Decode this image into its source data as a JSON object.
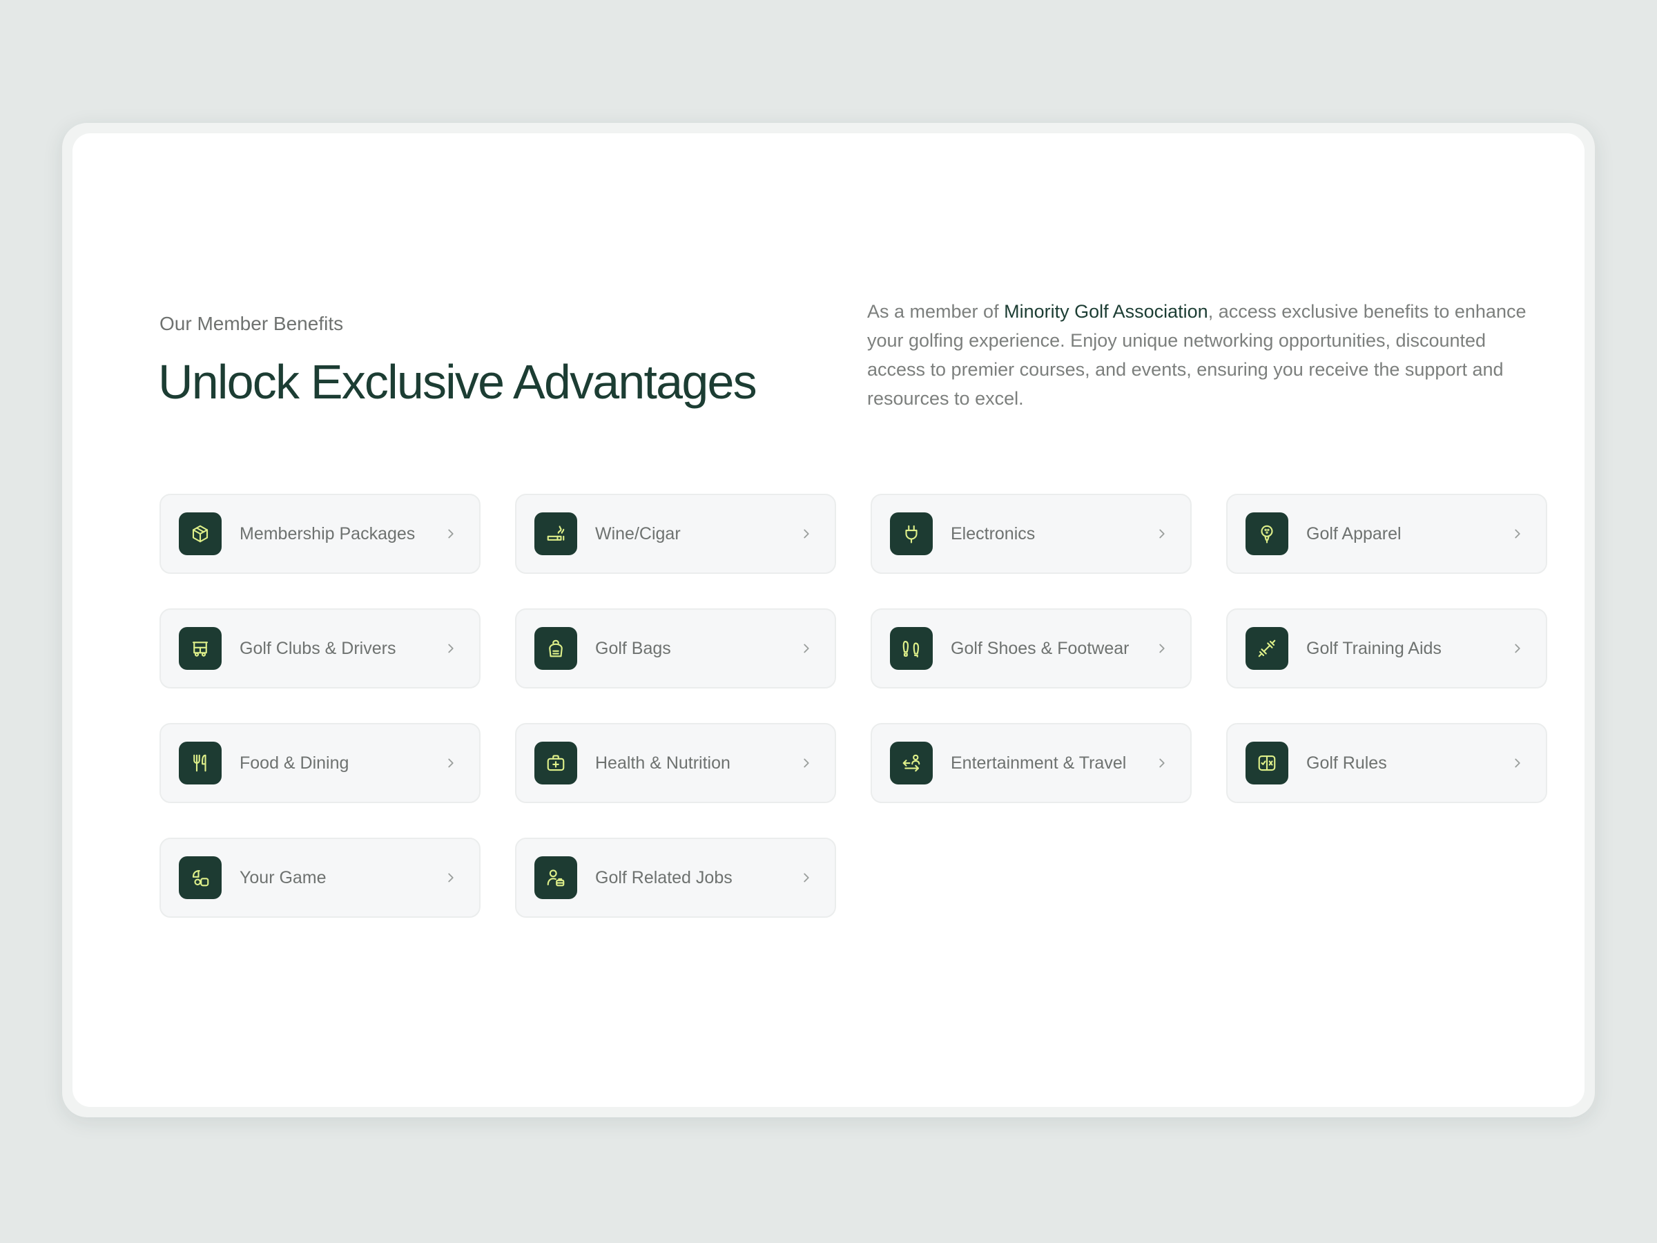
{
  "header": {
    "eyebrow": "Our Member Benefits",
    "title": "Unlock Exclusive Advantages"
  },
  "intro": {
    "prefix": "As a member of ",
    "organization": "Minority Golf Association",
    "suffix": ", access exclusive benefits to enhance your golfing experience. Enjoy unique networking opportunities, discounted access to premier courses, and events, ensuring you receive the support and resources to excel."
  },
  "colors": {
    "brand": "#1c3d33",
    "icon_tile": "#1d3b32",
    "icon_stroke": "#dff08a",
    "page_background": "#e4e8e7",
    "tile_background": "#f6f7f8"
  },
  "benefits": [
    {
      "label": "Membership Packages",
      "icon": "package-icon"
    },
    {
      "label": "Wine/Cigar",
      "icon": "cigar-icon"
    },
    {
      "label": "Electronics",
      "icon": "plug-icon"
    },
    {
      "label": "Golf Apparel",
      "icon": "golf-ball-tee-icon"
    },
    {
      "label": "Golf Clubs & Drivers",
      "icon": "golf-cart-icon"
    },
    {
      "label": "Golf Bags",
      "icon": "golf-bag-icon"
    },
    {
      "label": "Golf Shoes & Footwear",
      "icon": "footprints-icon"
    },
    {
      "label": "Golf Training Aids",
      "icon": "dumbbell-icon"
    },
    {
      "label": "Food & Dining",
      "icon": "utensils-icon"
    },
    {
      "label": "Health & Nutrition",
      "icon": "medical-kit-icon"
    },
    {
      "label": "Entertainment & Travel",
      "icon": "traveler-icon"
    },
    {
      "label": "Golf Rules",
      "icon": "rule-book-icon"
    },
    {
      "label": "Your Game",
      "icon": "game-shapes-icon"
    },
    {
      "label": "Golf Related Jobs",
      "icon": "job-seeker-icon"
    }
  ]
}
